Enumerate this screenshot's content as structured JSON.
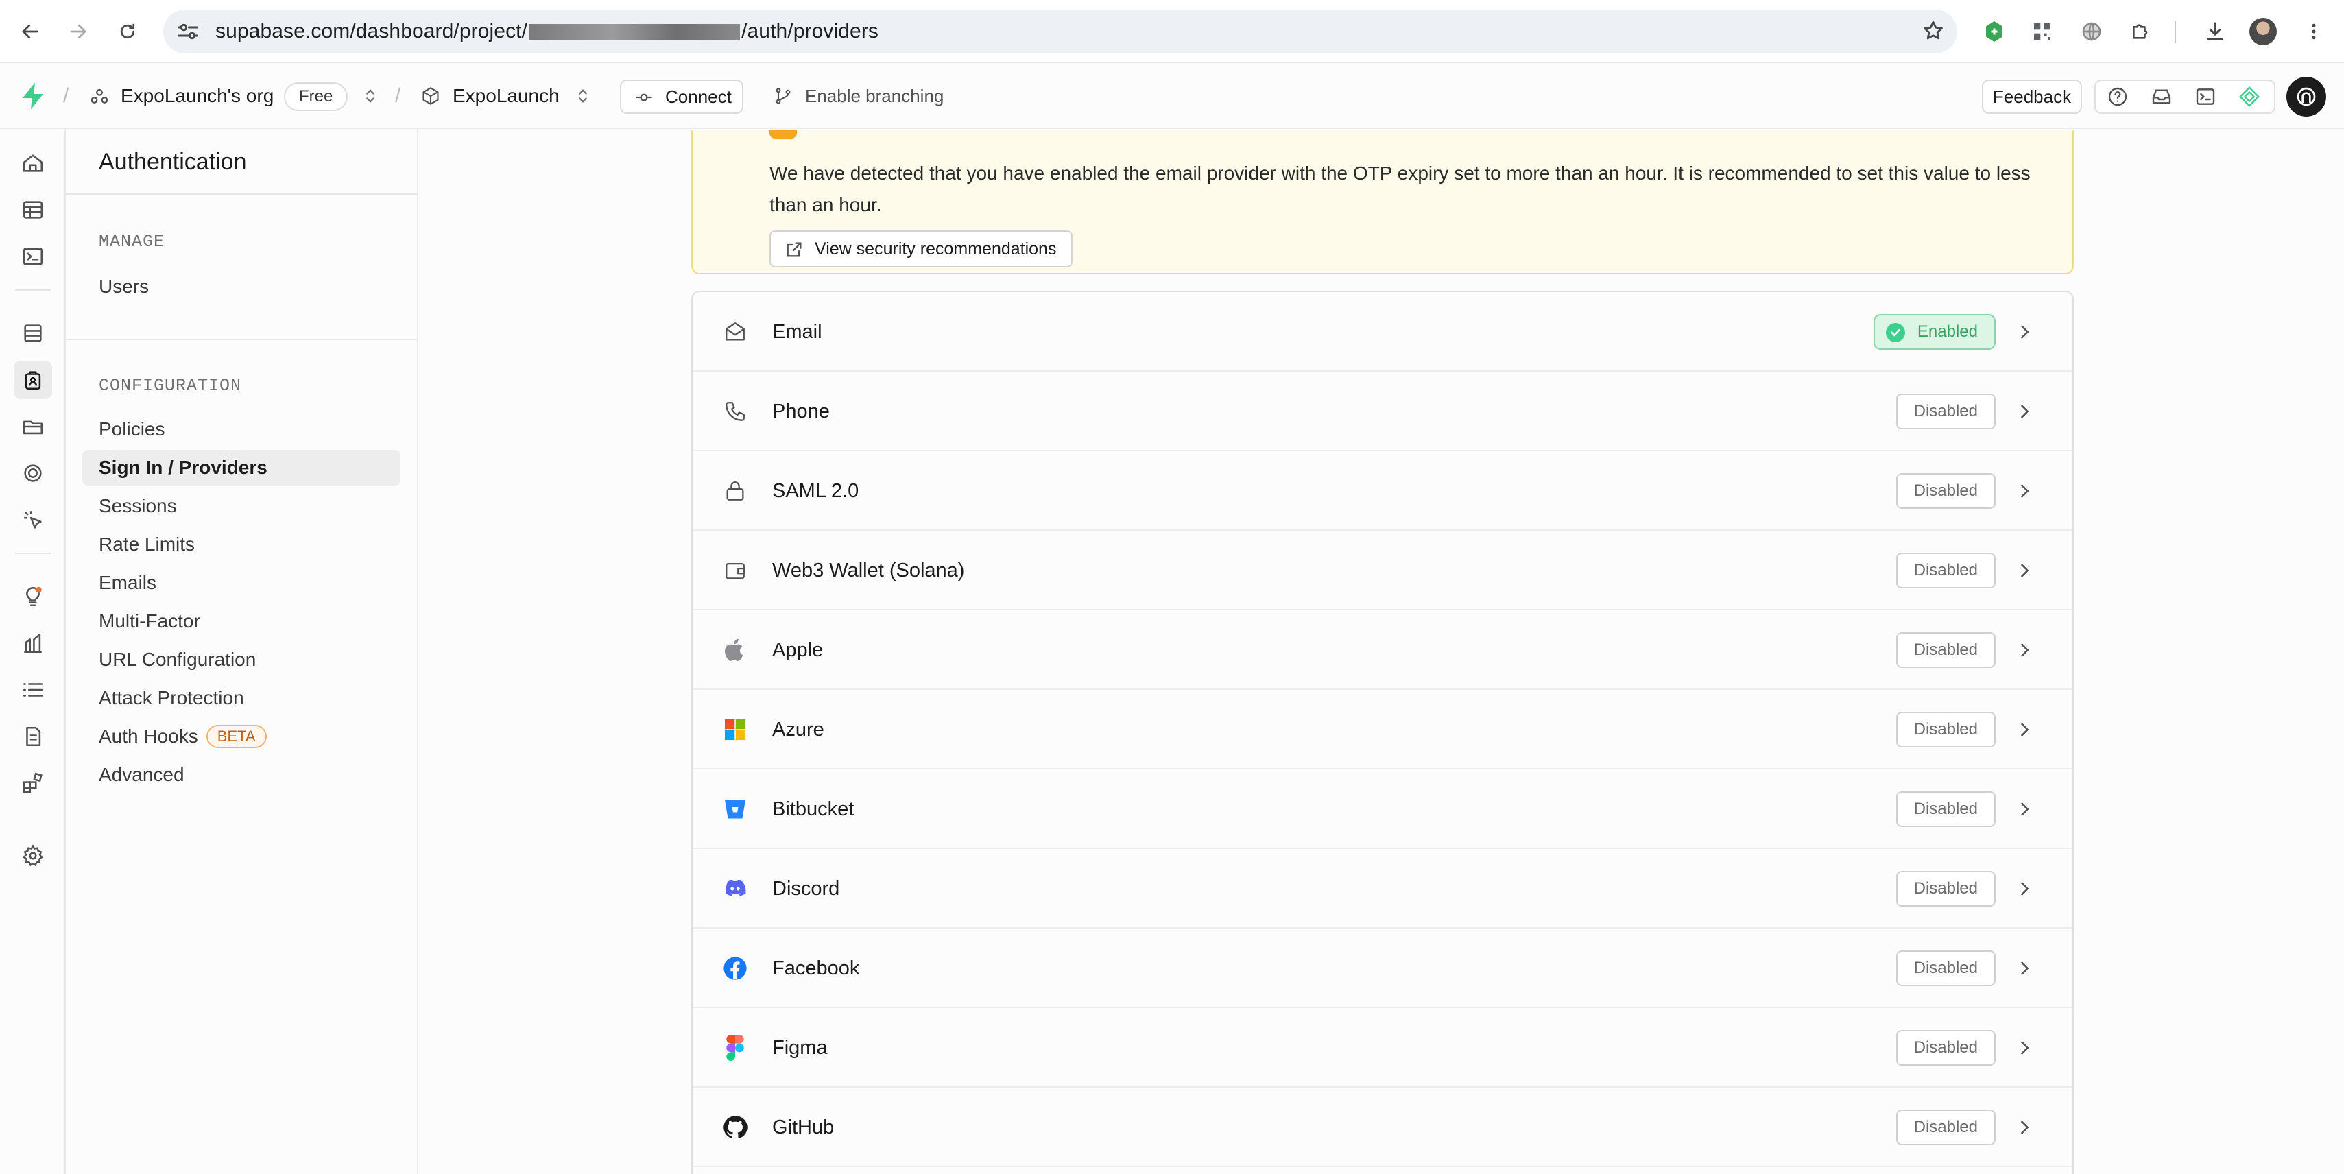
{
  "browser": {
    "url_prefix": "supabase.com/dashboard/project/",
    "url_suffix": "/auth/providers"
  },
  "header": {
    "org_name": "ExpoLaunch's org",
    "plan_badge": "Free",
    "project_name": "ExpoLaunch",
    "connect_label": "Connect",
    "branching_label": "Enable branching",
    "feedback_label": "Feedback"
  },
  "menu": {
    "title": "Authentication",
    "sections": [
      {
        "heading": "MANAGE",
        "items": [
          "Users"
        ]
      },
      {
        "heading": "CONFIGURATION",
        "items": [
          "Policies",
          "Sign In / Providers",
          "Sessions",
          "Rate Limits",
          "Emails",
          "Multi-Factor",
          "URL Configuration",
          "Attack Protection",
          "Auth Hooks",
          "Advanced"
        ]
      }
    ],
    "beta_badge": "BETA",
    "active_item": "Sign In / Providers"
  },
  "notice": {
    "text": "We have detected that you have enabled the email provider with the OTP expiry set to more than an hour. It is recommended to set this value to less than an hour.",
    "button_label": "View security recommendations"
  },
  "providers": [
    {
      "name": "Email",
      "status": "Enabled",
      "icon": "mail-icon"
    },
    {
      "name": "Phone",
      "status": "Disabled",
      "icon": "phone-icon"
    },
    {
      "name": "SAML 2.0",
      "status": "Disabled",
      "icon": "lock-icon"
    },
    {
      "name": "Web3 Wallet (Solana)",
      "status": "Disabled",
      "icon": "wallet-icon"
    },
    {
      "name": "Apple",
      "status": "Disabled",
      "icon": "apple-icon"
    },
    {
      "name": "Azure",
      "status": "Disabled",
      "icon": "azure-icon"
    },
    {
      "name": "Bitbucket",
      "status": "Disabled",
      "icon": "bitbucket-icon"
    },
    {
      "name": "Discord",
      "status": "Disabled",
      "icon": "discord-icon"
    },
    {
      "name": "Facebook",
      "status": "Disabled",
      "icon": "facebook-icon"
    },
    {
      "name": "Figma",
      "status": "Disabled",
      "icon": "figma-icon"
    },
    {
      "name": "GitHub",
      "status": "Disabled",
      "icon": "github-icon"
    }
  ],
  "colors": {
    "brand": "#3ecf8e",
    "enabled_bg": "#dcf5e5",
    "enabled_text": "#3aa263",
    "notice_bg": "#fffbeb",
    "notice_border": "#f5d98a",
    "beta": "#c2600c"
  }
}
